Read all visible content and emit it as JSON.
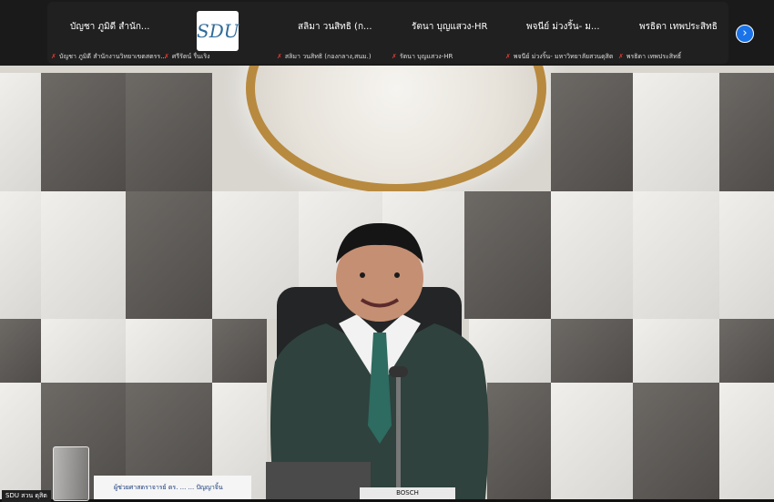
{
  "participants": [
    {
      "name": "บัญชา ภูมิดี สำนัก...",
      "sub": "บัญชา ภูมิดี สำนักงานวิทยาเขตสตรร..."
    },
    {
      "name": "",
      "sub": "ศรีรัตน์ รื่นเริง"
    },
    {
      "name": "สลิมา วนสิทธิ (ก...",
      "sub": "สลิมา วนสิทธิ (กองกลาง,สนม.)"
    },
    {
      "name": "รัตนา บุญแสวง-HR",
      "sub": "รัตนา บุญแสวง-HR"
    },
    {
      "name": "พจนีย์ ม่วงริ้น- ม...",
      "sub": "พจนีย์ ม่วงริ้น- มหาวิทยาลัยสวนดุสิต"
    },
    {
      "name": "พรธิดา เทพประสิทธิ",
      "sub": "พรธิดา เทพประสิทธิ์"
    }
  ],
  "logo_text": "SDU",
  "mic_muted_icon": "✗",
  "next_icon": "›",
  "bottom_label": "SDU สวน ดุสิต",
  "nameplate": "ผู้ช่วยศาสตราจารย์ ดร. ... ... ปัญญาจิ้น",
  "brand": "BOSCH",
  "colors": {
    "accent": "#1a73e8",
    "muted": "#e53935",
    "logo": "#b88a3f"
  }
}
